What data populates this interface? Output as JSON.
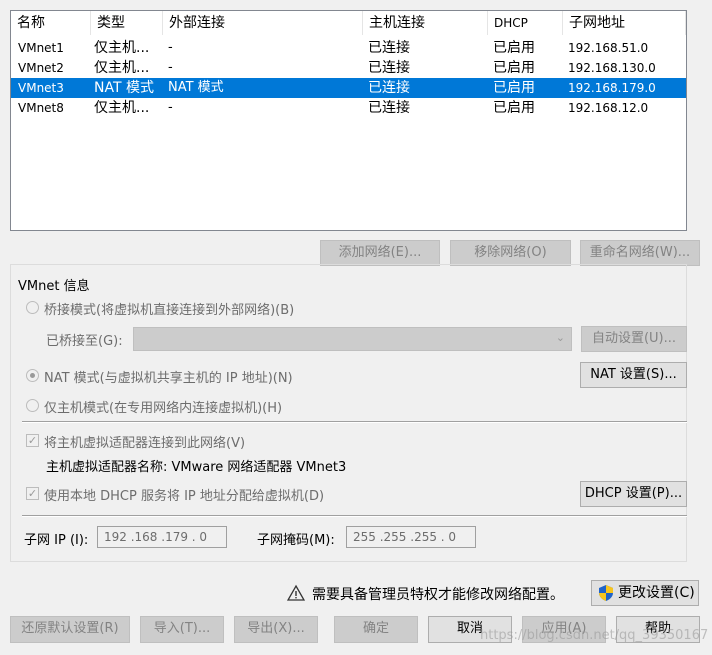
{
  "network_list": {
    "columns": [
      "名称",
      "类型",
      "外部连接",
      "主机连接",
      "DHCP",
      "子网地址"
    ],
    "rows": [
      {
        "name": "VMnet1",
        "type": "仅主机...",
        "external": "-",
        "host": "已连接",
        "dhcp": "已启用",
        "subnet": "192.168.51.0"
      },
      {
        "name": "VMnet2",
        "type": "仅主机...",
        "external": "-",
        "host": "已连接",
        "dhcp": "已启用",
        "subnet": "192.168.130.0"
      },
      {
        "name": "VMnet3",
        "type": "NAT 模式",
        "external": "NAT 模式",
        "host": "已连接",
        "dhcp": "已启用",
        "subnet": "192.168.179.0"
      },
      {
        "name": "VMnet8",
        "type": "仅主机...",
        "external": "-",
        "host": "已连接",
        "dhcp": "已启用",
        "subnet": "192.168.12.0"
      }
    ],
    "selected_row": 2
  },
  "list_buttons": {
    "add": "添加网络(E)...",
    "remove": "移除网络(O)",
    "rename": "重命名网络(W)..."
  },
  "vmnet_info": {
    "group_title": "VMnet 信息",
    "bridge_mode": "桥接模式(将虚拟机直接连接到外部网络)(B)",
    "bridged_to_label": "已桥接至(G):",
    "auto_settings": "自动设置(U)...",
    "nat_mode": "NAT 模式(与虚拟机共享主机的 IP 地址)(N)",
    "nat_settings": "NAT 设置(S)...",
    "host_only_mode": "仅主机模式(在专用网络内连接虚拟机)(H)",
    "selected_mode": "nat",
    "connect_adapter": "将主机虚拟适配器连接到此网络(V)",
    "connect_adapter_checked": true,
    "adapter_name": "主机虚拟适配器名称: VMware 网络适配器 VMnet3",
    "use_dhcp": "使用本地 DHCP 服务将 IP 地址分配给虚拟机(D)",
    "use_dhcp_checked": true,
    "dhcp_settings": "DHCP 设置(P)...",
    "subnet_ip_label": "子网 IP (I):",
    "subnet_ip_value": "192 .168 .179 . 0",
    "subnet_mask_label": "子网掩码(M):",
    "subnet_mask_value": "255 .255 .255 . 0"
  },
  "admin_notice": "需要具备管理员特权才能修改网络配置。",
  "change_settings": "更改设置(C)",
  "footer": {
    "restore_defaults": "还原默认设置(R)",
    "import": "导入(T)...",
    "export": "导出(X)...",
    "ok": "确定",
    "cancel": "取消",
    "apply": "应用(A)",
    "help": "帮助"
  },
  "watermark": "https://blog.csdn.net/qq_39350167",
  "icons": {
    "warning": "warning-icon",
    "shield": "uac-shield-icon",
    "dropdown": "chevron-down-icon"
  },
  "colors": {
    "selection": "#0078d7",
    "window_bg": "#f0f0f0"
  }
}
